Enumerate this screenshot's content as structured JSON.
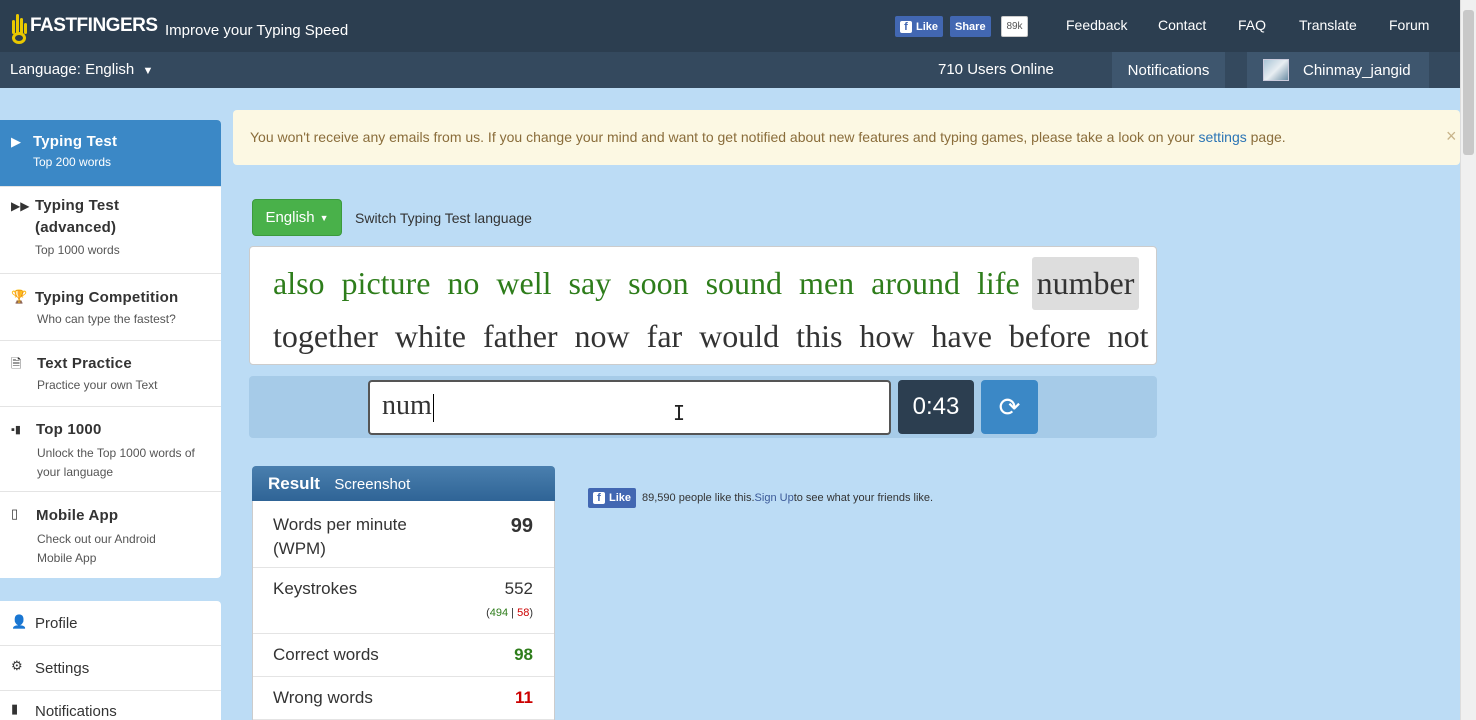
{
  "header": {
    "logo_text": "FASTFINGERS",
    "tagline": "Improve your Typing Speed",
    "fb_like": "Like",
    "fb_share": "Share",
    "fb_count": "89k",
    "nav": [
      "Feedback",
      "Contact",
      "FAQ",
      "Translate",
      "Forum"
    ]
  },
  "subbar": {
    "language": "Language: English",
    "users_online": "710 Users Online",
    "notifications": "Notifications",
    "username": "Chinmay_jangid"
  },
  "sidebar": {
    "items": [
      {
        "title": "Typing Test",
        "sub": "Top 200 words",
        "icon": "play-icon"
      },
      {
        "title": "Typing Test (advanced)",
        "sub": "Top 1000 words",
        "icon": "fast-forward-icon"
      },
      {
        "title": "Typing Competition",
        "sub": "Who can type the fastest?",
        "icon": "trophy-icon"
      },
      {
        "title": "Text Practice",
        "sub": "Practice your own Text",
        "icon": "document-icon"
      },
      {
        "title": "Top 1000",
        "sub": "Unlock the Top 1000 words of your language",
        "icon": "signal-icon"
      },
      {
        "title": "Mobile App",
        "sub": "Check out our Android Mobile App",
        "icon": "phone-icon"
      }
    ],
    "account": [
      {
        "label": "Profile",
        "icon": "user-icon"
      },
      {
        "label": "Settings",
        "icon": "gear-icon"
      },
      {
        "label": "Notifications",
        "icon": "comment-icon"
      }
    ]
  },
  "alert": {
    "text_before": "You won't receive any emails from us. If you change your mind and want to get notified about new features and typing games, please take a look on your ",
    "link": "settings",
    "text_after": " page.",
    "close": "×"
  },
  "test": {
    "language_button": "English",
    "switch_label": "Switch Typing Test language",
    "line1_done": [
      "also",
      "picture",
      "no",
      "well",
      "say",
      "soon",
      "sound",
      "men",
      "around",
      "life"
    ],
    "current_word": "number",
    "line2": [
      "together",
      "white",
      "father",
      "now",
      "far",
      "would",
      "this",
      "how",
      "have",
      "before",
      "not"
    ],
    "input_value": "num",
    "timer": "0:43"
  },
  "result": {
    "title": "Result",
    "screenshot": "Screenshot",
    "wpm_label": "Words per minute (WPM)",
    "wpm_value": "99",
    "keystrokes_label": "Keystrokes",
    "keystrokes_value": "552",
    "keystrokes_correct": "494",
    "keystrokes_sep": "|",
    "keystrokes_wrong": "58",
    "correct_label": "Correct words",
    "correct_value": "98",
    "wrong_label": "Wrong words",
    "wrong_value": "11"
  },
  "fb_widget": {
    "like": "Like",
    "text_before": "89,590 people like this. ",
    "signup": "Sign Up",
    "text_after": " to see what your friends like."
  },
  "colors": {
    "topbar": "#2c3e50",
    "subbar": "#34495e",
    "accent": "#3b88c6",
    "background": "#bcdcf5",
    "correct": "#2e7d1b",
    "wrong": "#cc0000"
  }
}
